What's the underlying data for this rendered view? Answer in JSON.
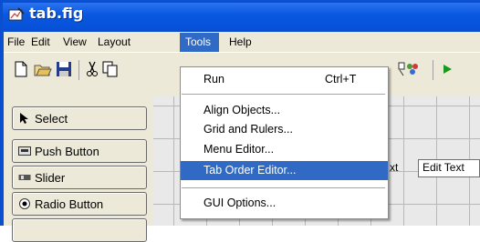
{
  "window": {
    "title": "tab.fig"
  },
  "menubar": {
    "items": [
      "File",
      "Edit",
      "View",
      "Layout",
      "Tools",
      "Help"
    ],
    "active": "Tools"
  },
  "toolbar": {
    "run_icon": "play-icon"
  },
  "tools_menu": {
    "items": [
      {
        "label": "Run",
        "shortcut": "Ctrl+T"
      },
      {
        "label": "Align Objects..."
      },
      {
        "label": "Grid and Rulers..."
      },
      {
        "label": "Menu Editor..."
      },
      {
        "label": "Tab Order Editor...",
        "highlighted": true
      },
      {
        "label": "GUI Options..."
      }
    ]
  },
  "palette": {
    "items": [
      {
        "label": "Select",
        "icon": "cursor-arrow-icon"
      },
      {
        "label": "Push Button",
        "icon": "push-button-icon"
      },
      {
        "label": "Slider",
        "icon": "slider-icon"
      },
      {
        "label": "Radio Button",
        "icon": "radio-button-icon"
      }
    ]
  },
  "canvas": {
    "text_fragment": "xt",
    "edit_text": "Edit Text"
  },
  "colors": {
    "titlebar": "#0a58e0",
    "menu_highlight": "#316ac5",
    "chrome": "#ece9d8"
  }
}
